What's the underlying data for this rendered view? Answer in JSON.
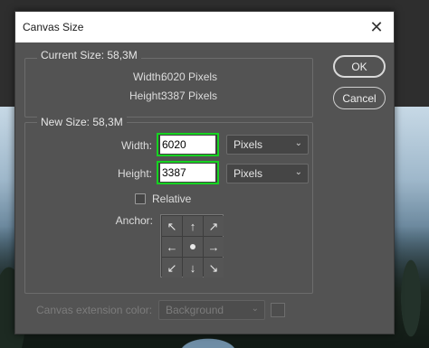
{
  "dialog": {
    "title": "Canvas Size",
    "close_glyph": "✕",
    "buttons": {
      "ok": "OK",
      "cancel": "Cancel"
    },
    "current_size": {
      "legend": "Current Size: 58,3M",
      "width_label": "Width:",
      "width_value": "6020 Pixels",
      "height_label": "Height:",
      "height_value": "3387 Pixels"
    },
    "new_size": {
      "legend": "New Size: 58,3M",
      "width_label": "Width:",
      "width_value": "6020",
      "width_unit": "Pixels",
      "height_label": "Height:",
      "height_value": "3387",
      "height_unit": "Pixels",
      "relative_label": "Relative",
      "relative_checked": false,
      "anchor_label": "Anchor:",
      "anchor_arrows": [
        "↖",
        "↑",
        "↗",
        "←",
        "",
        "→",
        "↙",
        "↓",
        "↘"
      ]
    },
    "extension": {
      "label": "Canvas extension color:",
      "value": "Background"
    },
    "highlight_color": "#16d321"
  }
}
